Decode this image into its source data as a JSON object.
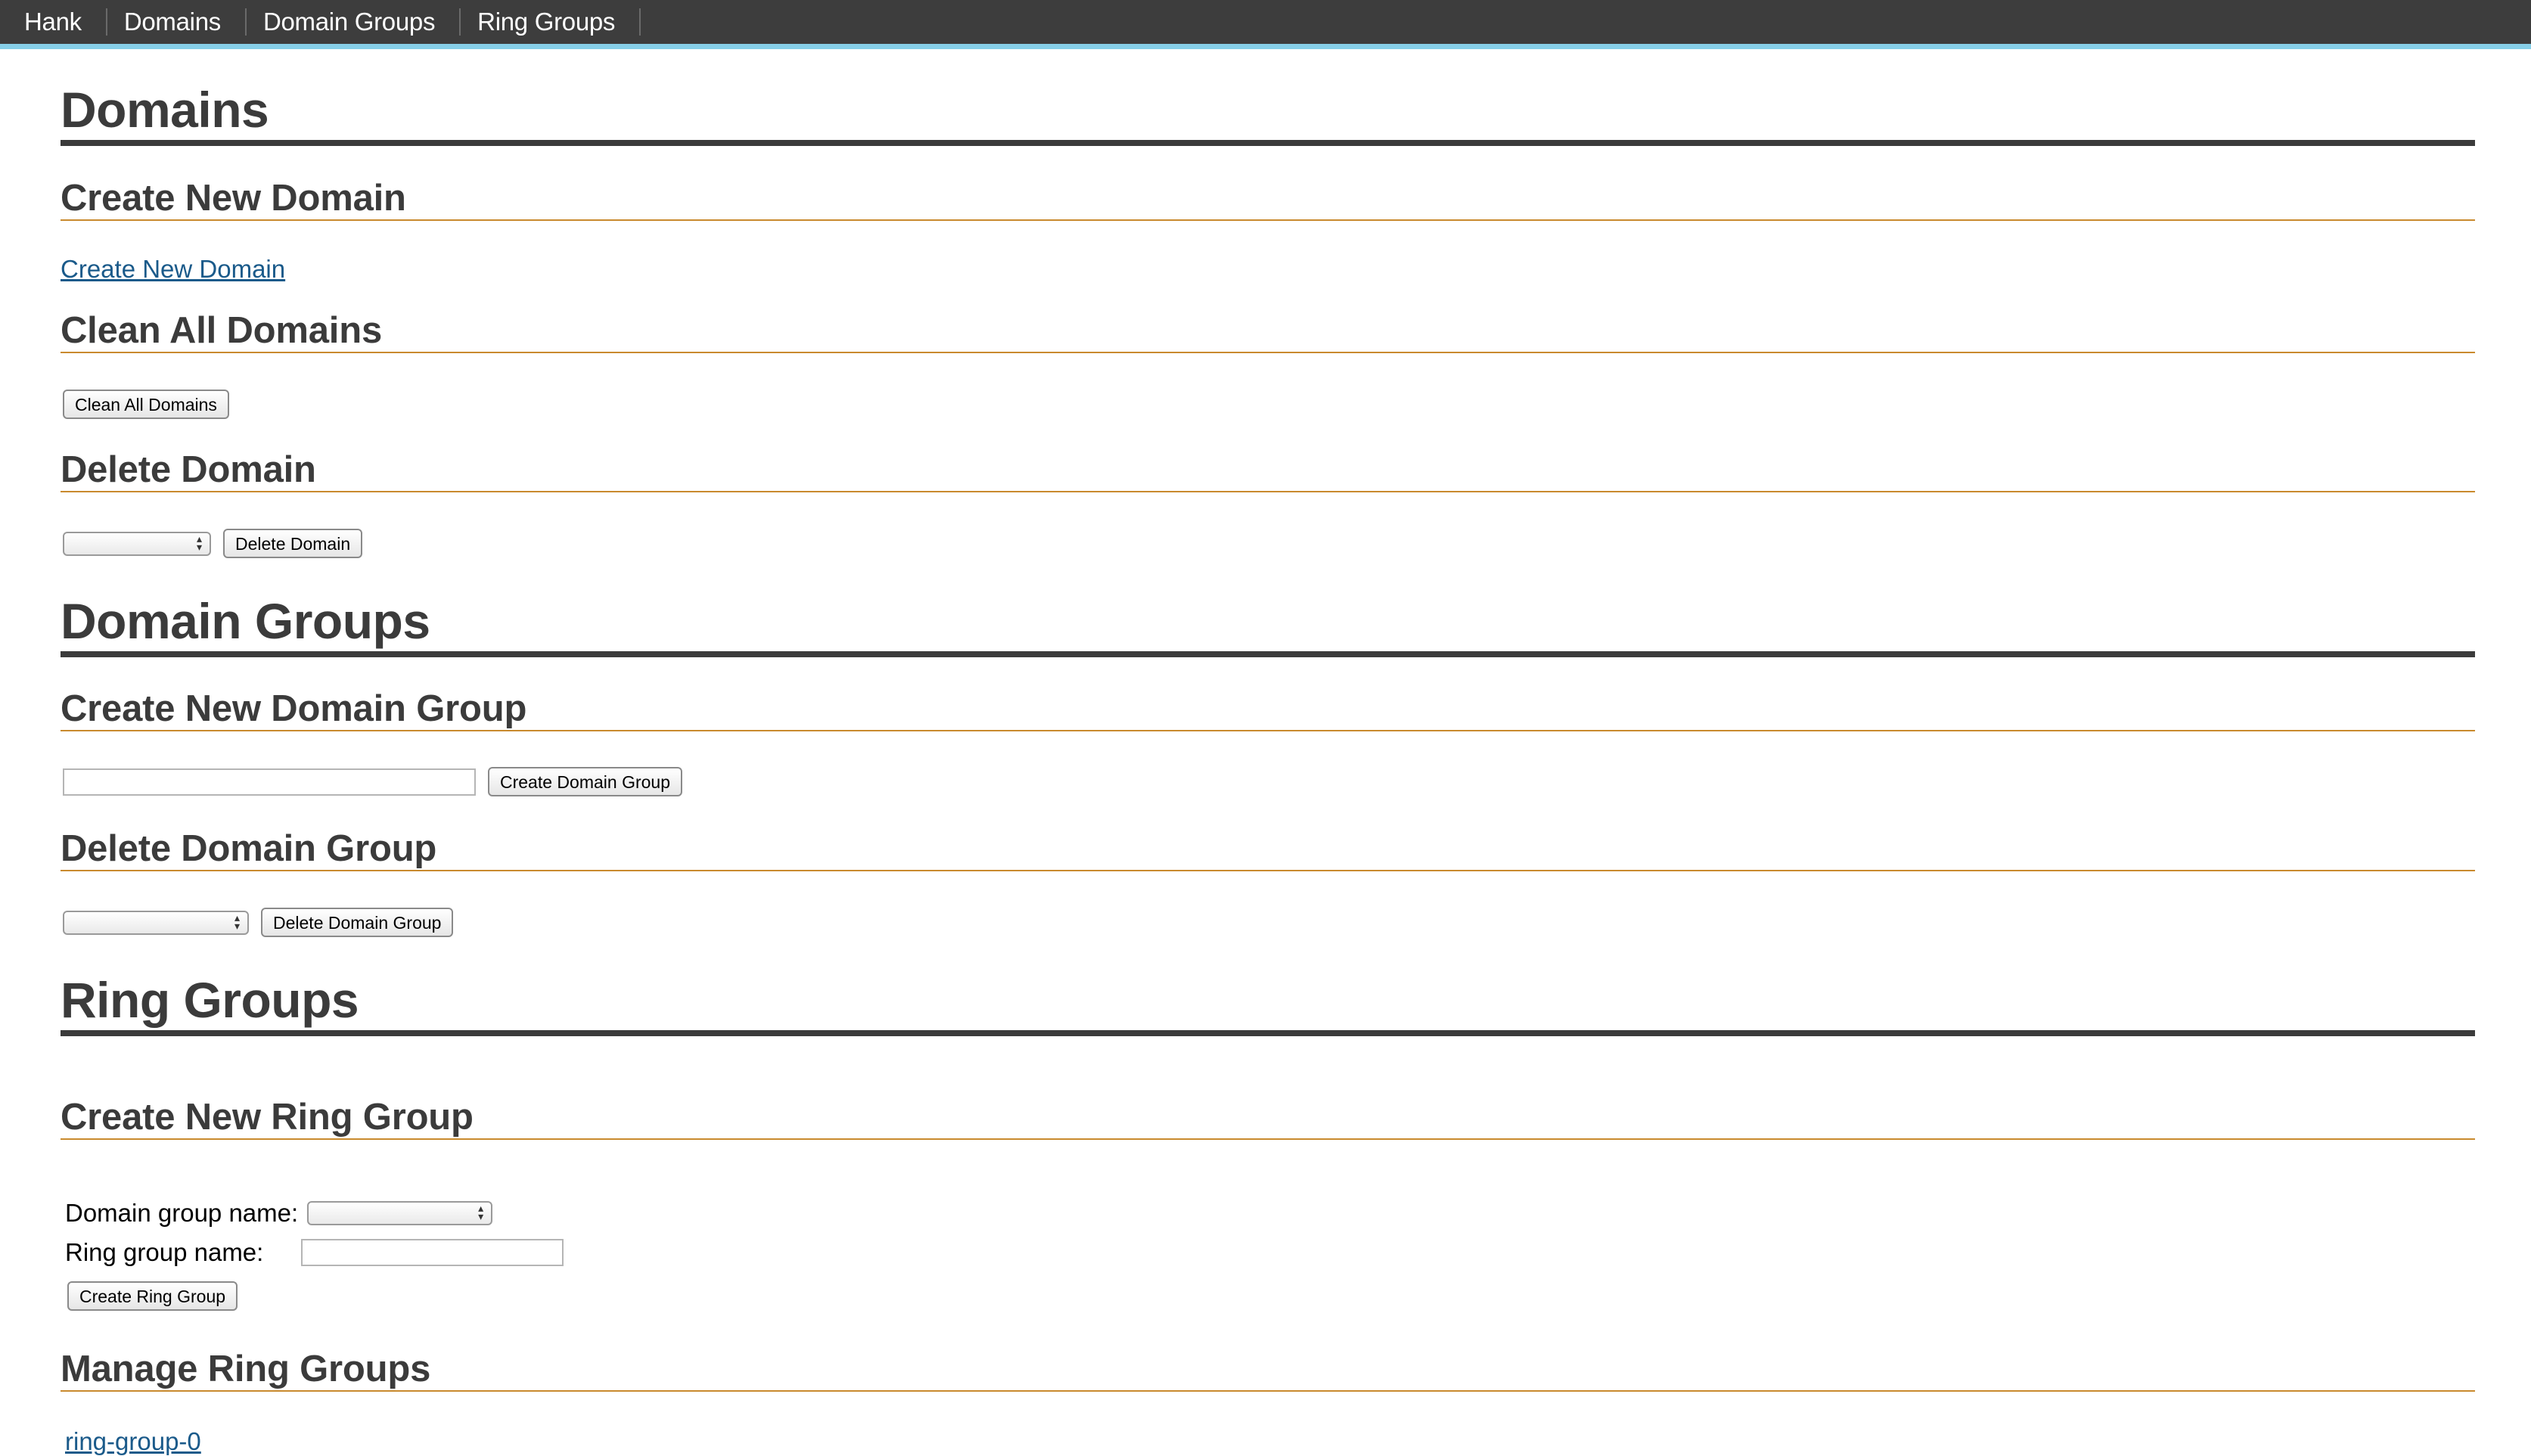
{
  "nav": {
    "items": [
      "Hank",
      "Domains",
      "Domain Groups",
      "Ring Groups"
    ]
  },
  "domains": {
    "title": "Domains",
    "create": {
      "heading": "Create New Domain",
      "link": "Create New Domain"
    },
    "clean": {
      "heading": "Clean All Domains",
      "button": "Clean All Domains"
    },
    "delete": {
      "heading": "Delete Domain",
      "selected": "",
      "button": "Delete Domain"
    }
  },
  "domain_groups": {
    "title": "Domain Groups",
    "create": {
      "heading": "Create New Domain Group",
      "input_value": "",
      "button": "Create Domain Group"
    },
    "delete": {
      "heading": "Delete Domain Group",
      "selected": "",
      "button": "Delete Domain Group"
    }
  },
  "ring_groups": {
    "title": "Ring Groups",
    "create": {
      "heading": "Create New Ring Group",
      "domain_group_label": "Domain group name:",
      "domain_group_selected": "",
      "ring_group_label": "Ring group name:",
      "ring_group_value": "",
      "button": "Create Ring Group"
    },
    "manage": {
      "heading": "Manage Ring Groups",
      "items": [
        "ring-group-0"
      ]
    }
  },
  "colors": {
    "nav_bg": "#3d3d3d",
    "nav_accent": "#86cfe8",
    "heading": "#3b3b3b",
    "subheading_rule": "#c98a2e",
    "link": "#1a5a8a"
  }
}
